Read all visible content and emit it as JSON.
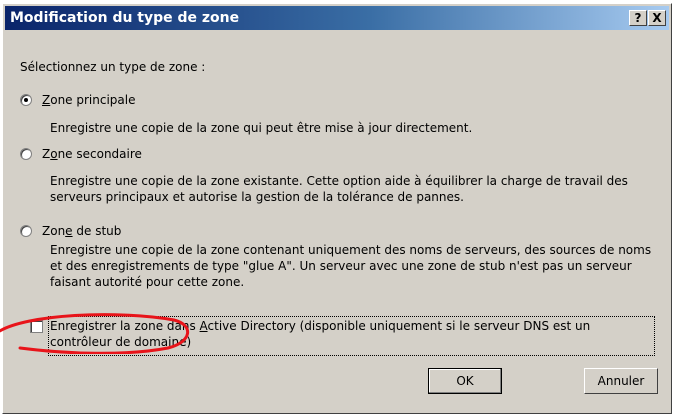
{
  "window": {
    "title": "Modification du type de zone",
    "help_label": "?",
    "close_label": "X"
  },
  "prompt": "Sélectionnez un type de zone :",
  "options": [
    {
      "label_accel": "Z",
      "label_rest": "one principale",
      "selected": true,
      "description": "Enregistre une copie de la zone qui peut être mise à jour directement."
    },
    {
      "label_pre": "Z",
      "label_accel": "o",
      "label_rest": "ne secondaire",
      "selected": false,
      "description": "Enregistre une copie de la zone existante. Cette option aide à équilibrer la charge de travail des serveurs principaux et autorise la gestion de la tolérance de pannes."
    },
    {
      "label_pre": "Zon",
      "label_accel": "e",
      "label_rest": " de stub",
      "selected": false,
      "description": "Enregistre une copie de la zone contenant uniquement des noms de serveurs, des sources de noms et des enregistrements de type \"glue A\". Un serveur avec une zone de stub n'est pas un serveur faisant autorité pour cette zone."
    }
  ],
  "checkbox": {
    "checked": false,
    "label_pre": "Enregistrer la zone dans ",
    "label_accel": "A",
    "label_rest": "ctive Directory (disponible uniquement si le serveur DNS est un contrôleur de domaine)"
  },
  "buttons": {
    "ok": "OK",
    "cancel": "Annuler"
  },
  "annotation_color": "#e8141a"
}
